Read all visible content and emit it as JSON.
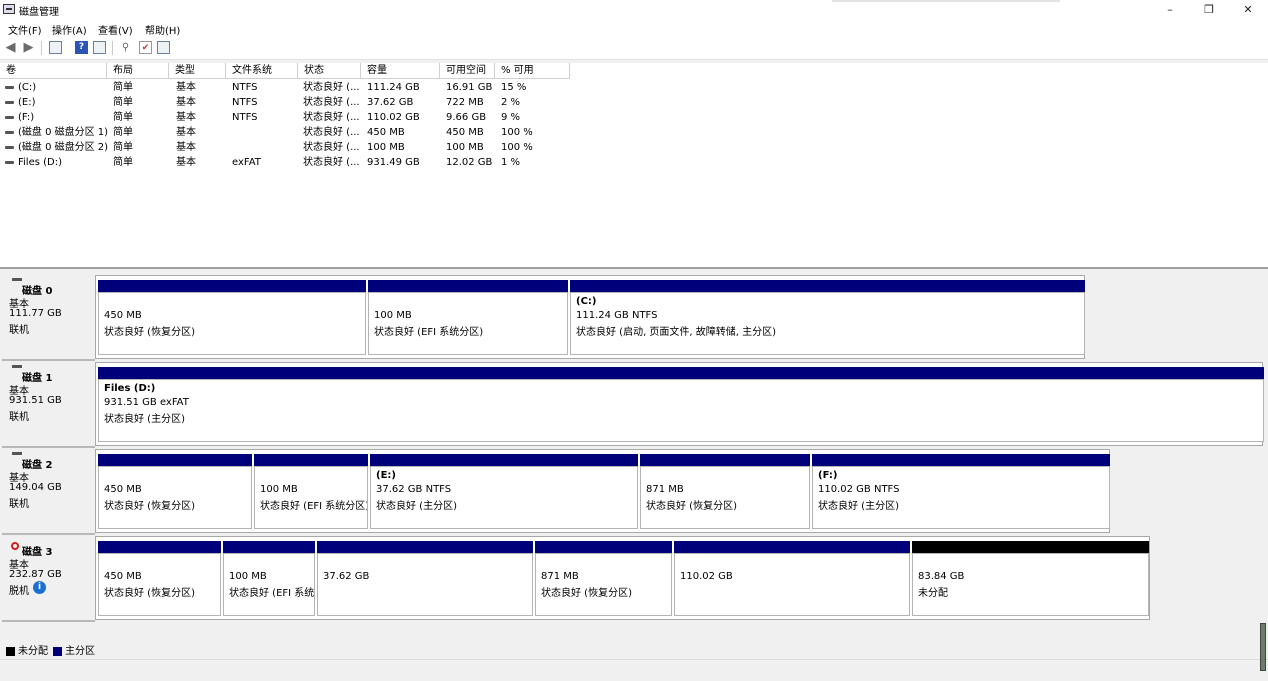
{
  "window": {
    "title": "磁盘管理",
    "minimize_glyph": "–",
    "restore_glyph": "❐",
    "close_glyph": "✕"
  },
  "menu": [
    "文件(F)",
    "操作(A)",
    "查看(V)",
    "帮助(H)"
  ],
  "toolbar": {
    "icons": [
      "back-arrow-icon",
      "forward-arrow-icon",
      "console-icon",
      "help-icon",
      "properties-icon",
      "connect-icon",
      "checklist-icon",
      "list-view-icon"
    ],
    "back_glyph": "◀",
    "forward_glyph": "▶",
    "help_glyph": "?",
    "check_glyph": "✔"
  },
  "volume_list": {
    "columns": [
      "卷",
      "布局",
      "类型",
      "文件系统",
      "状态",
      "容量",
      "可用空间",
      "% 可用"
    ],
    "rows": [
      [
        "(C:)",
        "简单",
        "基本",
        "NTFS",
        "状态良好 (...",
        "111.24 GB",
        "16.91 GB",
        "15 %"
      ],
      [
        "(E:)",
        "简单",
        "基本",
        "NTFS",
        "状态良好 (...",
        "37.62 GB",
        "722 MB",
        "2 %"
      ],
      [
        "(F:)",
        "简单",
        "基本",
        "NTFS",
        "状态良好 (...",
        "110.02 GB",
        "9.66 GB",
        "9 %"
      ],
      [
        "(磁盘 0 磁盘分区 1)",
        "简单",
        "基本",
        "",
        "状态良好 (...",
        "450 MB",
        "450 MB",
        "100 %"
      ],
      [
        "(磁盘 0 磁盘分区 2)",
        "简单",
        "基本",
        "",
        "状态良好 (...",
        "100 MB",
        "100 MB",
        "100 %"
      ],
      [
        "Files (D:)",
        "简单",
        "基本",
        "exFAT",
        "状态良好 (...",
        "931.49 GB",
        "12.02 GB",
        "1 %"
      ]
    ]
  },
  "disks": [
    {
      "name": "磁盘 0",
      "type": "基本",
      "size": "111.77 GB",
      "status": "联机",
      "partitions": [
        {
          "title": "",
          "lines": [
            "450 MB",
            "状态良好 (恢复分区)"
          ],
          "kind": "primary"
        },
        {
          "title": "",
          "lines": [
            "100 MB",
            "状态良好 (EFI 系统分区)"
          ],
          "kind": "primary"
        },
        {
          "title": "(C:)",
          "lines": [
            "111.24 GB NTFS",
            "状态良好 (启动, 页面文件, 故障转储, 主分区)"
          ],
          "kind": "primary"
        }
      ]
    },
    {
      "name": "磁盘 1",
      "type": "基本",
      "size": "931.51 GB",
      "status": "联机",
      "partitions": [
        {
          "title": "Files  (D:)",
          "lines": [
            "931.51 GB exFAT",
            "状态良好 (主分区)"
          ],
          "kind": "primary"
        }
      ]
    },
    {
      "name": "磁盘 2",
      "type": "基本",
      "size": "149.04 GB",
      "status": "联机",
      "partitions": [
        {
          "title": "",
          "lines": [
            "450 MB",
            "状态良好 (恢复分区)"
          ],
          "kind": "primary"
        },
        {
          "title": "",
          "lines": [
            "100 MB",
            "状态良好 (EFI 系统分区)"
          ],
          "kind": "primary"
        },
        {
          "title": "(E:)",
          "lines": [
            "37.62 GB NTFS",
            "状态良好 (主分区)"
          ],
          "kind": "primary"
        },
        {
          "title": "",
          "lines": [
            "871 MB",
            "状态良好 (恢复分区)"
          ],
          "kind": "primary"
        },
        {
          "title": "(F:)",
          "lines": [
            "110.02 GB NTFS",
            "状态良好 (主分区)"
          ],
          "kind": "primary"
        }
      ]
    },
    {
      "name": "磁盘 3",
      "type": "基本",
      "size": "232.87 GB",
      "status": "脱机",
      "offline": true,
      "info_glyph": "i",
      "partitions": [
        {
          "title": "",
          "lines": [
            "450 MB",
            "状态良好 (恢复分区)"
          ],
          "kind": "primary"
        },
        {
          "title": "",
          "lines": [
            "100 MB",
            "状态良好 (EFI 系统"
          ],
          "kind": "primary"
        },
        {
          "title": "",
          "lines": [
            "37.62 GB"
          ],
          "kind": "primary"
        },
        {
          "title": "",
          "lines": [
            "871 MB",
            "状态良好 (恢复分区)"
          ],
          "kind": "primary"
        },
        {
          "title": "",
          "lines": [
            "110.02 GB"
          ],
          "kind": "primary"
        },
        {
          "title": "",
          "lines": [
            "83.84 GB",
            "未分配"
          ],
          "kind": "unallocated"
        }
      ]
    }
  ],
  "legend": [
    {
      "label": "未分配",
      "color": "#000000"
    },
    {
      "label": "主分区",
      "color": "#00007a"
    }
  ],
  "colors": {
    "primary": "#00007a",
    "unallocated": "#000000",
    "offline": "#d21e1e",
    "info": "#1a6fd1"
  }
}
